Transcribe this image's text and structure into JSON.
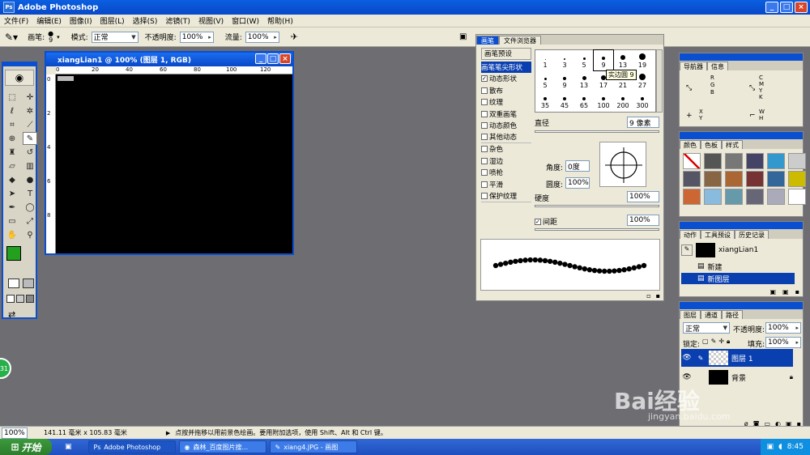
{
  "app": {
    "title": "Adobe Photoshop"
  },
  "menu": [
    "文件(F)",
    "编辑(E)",
    "图像(I)",
    "图层(L)",
    "选择(S)",
    "滤镜(T)",
    "视图(V)",
    "窗口(W)",
    "帮助(H)"
  ],
  "options": {
    "brush_label": "画笔:",
    "brush_size": "9",
    "mode_label": "模式:",
    "mode_value": "正常",
    "opacity_label": "不透明度:",
    "opacity_value": "100%",
    "flow_label": "流量:",
    "flow_value": "100%"
  },
  "document": {
    "title": "xiangLian1 @ 100% (图层 1, RGB)",
    "ruler_ticks": [
      "0",
      "20",
      "40",
      "60",
      "80",
      "100",
      "120"
    ],
    "v_ticks": [
      "0",
      "2",
      "4",
      "6",
      "8"
    ]
  },
  "brush_panel": {
    "tabs": [
      "画笔",
      "文件浏览器"
    ],
    "items": [
      {
        "label": "画笔预设",
        "check": false,
        "type": "hdr"
      },
      {
        "label": "画笔笔尖形状",
        "check": false,
        "type": "hl"
      },
      {
        "label": "动态形状",
        "check": true
      },
      {
        "label": "散布",
        "check": false
      },
      {
        "label": "纹理",
        "check": false
      },
      {
        "label": "双重画笔",
        "check": false
      },
      {
        "label": "动态颜色",
        "check": false
      },
      {
        "label": "其他动态",
        "check": false
      },
      {
        "label": "杂色",
        "check": false
      },
      {
        "label": "湿边",
        "check": false
      },
      {
        "label": "喷枪",
        "check": false
      },
      {
        "label": "平滑",
        "check": false
      },
      {
        "label": "保护纹理",
        "check": false
      }
    ],
    "sizes_row1": [
      "1",
      "3",
      "5",
      "9",
      "13",
      "19"
    ],
    "sizes_row2": [
      "5",
      "9",
      "13",
      "17",
      "21",
      "27"
    ],
    "sizes_row3": [
      "35",
      "45",
      "65",
      "100",
      "200",
      "300"
    ],
    "tooltip": "实边圆 9",
    "diameter_label": "直径",
    "diameter_value": "9 像素",
    "angle_label": "角度:",
    "angle_value": "0度",
    "roundness_label": "圆度:",
    "roundness_value": "100%",
    "hardness_label": "硬度",
    "hardness_value": "100%",
    "spacing_label": "间距",
    "spacing_value": "100%"
  },
  "navigator": {
    "tabs": [
      "导航器",
      "信息"
    ],
    "rgb": [
      "R",
      "G",
      "B"
    ],
    "cmyk": [
      "C",
      "M",
      "Y",
      "K"
    ],
    "xy": [
      "X",
      "Y"
    ],
    "wh": [
      "W",
      "H"
    ]
  },
  "color_panel": {
    "tabs": [
      "颜色",
      "色板",
      "样式"
    ]
  },
  "history": {
    "tabs": [
      "动作",
      "工具预设",
      "历史记录"
    ],
    "snapshot": "xiangLian1",
    "items": [
      "新建",
      "新图层"
    ]
  },
  "layers": {
    "tabs": [
      "图层",
      "通道",
      "路径"
    ],
    "mode": "正常",
    "opacity_label": "不透明度:",
    "opacity_value": "100%",
    "lock_label": "锁定:",
    "fill_label": "填充:",
    "fill_value": "100%",
    "items": [
      "图层 1",
      "背景"
    ]
  },
  "status": {
    "zoom": "100%",
    "size": "141.11 毫米 x 105.83 毫米",
    "hint": "点按并拖移以用前景色绘画。要用附加选项，使用 Shift、Alt 和 Ctrl 键。"
  },
  "taskbar": {
    "start": "开始",
    "tasks": [
      "Adobe Photoshop",
      "森林_百度图片搜...",
      "xiang4.JPG - 画图"
    ],
    "time": "8:45"
  },
  "watermark": {
    "brand": "Bai经验",
    "url": "jingyan.baidu.com"
  },
  "colors": {
    "foreground": "#22a01e",
    "background": "#000000",
    "accent": "#0a4fd0"
  }
}
